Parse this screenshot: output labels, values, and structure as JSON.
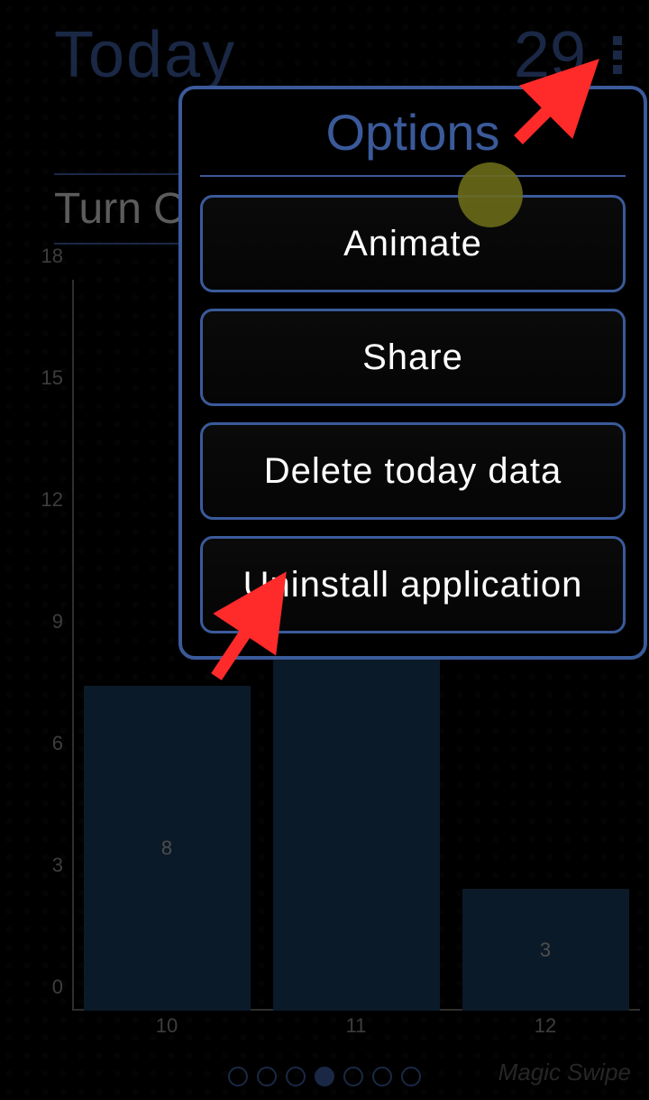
{
  "header": {
    "title": "Today",
    "count": "29"
  },
  "section_label": "Turn O",
  "chart_data": {
    "type": "bar",
    "categories": [
      "10",
      "11",
      "12"
    ],
    "values": [
      8,
      18,
      3
    ],
    "y_ticks": [
      "0",
      "3",
      "6",
      "9",
      "12",
      "15",
      "18"
    ],
    "y_max": 18
  },
  "pagination": {
    "total": 7,
    "active_index": 3
  },
  "footer_brand": "Magic Swipe",
  "modal": {
    "title": "Options",
    "buttons": [
      "Animate",
      "Share",
      "Delete today data",
      "Uninstall application"
    ]
  }
}
